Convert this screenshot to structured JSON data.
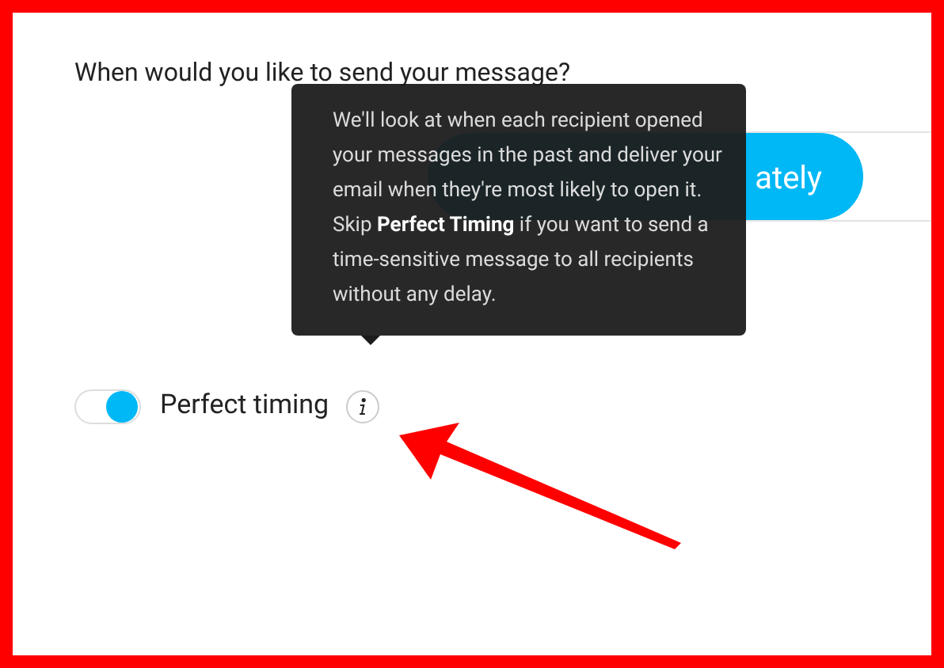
{
  "question": "When would you like to send your message?",
  "send_button": {
    "label": "ately"
  },
  "tooltip": {
    "text": "We'll look at when each recipient opened your messages in the past and deliver your email when they're most likely to open it. Skip **Perfect Timing** if you want to send a time-sensitive message to all recipients without any delay."
  },
  "toggle": {
    "label": "Perfect timing",
    "on": true
  }
}
